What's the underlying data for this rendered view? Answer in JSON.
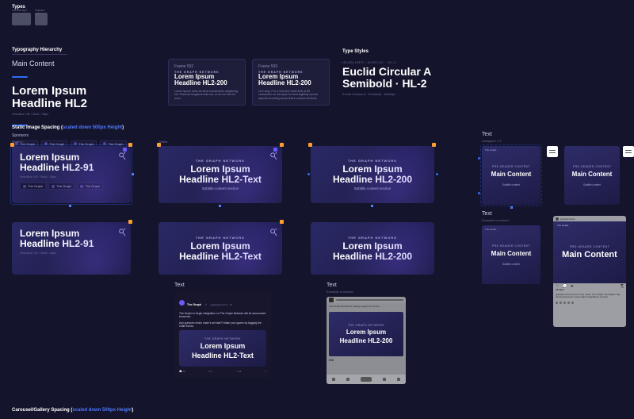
{
  "colors": {
    "accent": "#2f6cf5",
    "orange": "#ff9f2e",
    "purple": "#6a5af9",
    "bg": "#14142c",
    "panel": "#1e1d3a",
    "ink": "#ffffff",
    "dim": "#a09fc9"
  },
  "types": {
    "label": "Types",
    "swatches": [
      "Landscape",
      "Square 1:1"
    ]
  },
  "typography": {
    "label": "Typography Hierarchy",
    "main_pre": "Main Content",
    "headline_1": "Lorem Ipsum",
    "headline_2": "Headline HL2",
    "caption": "Headline Hl2 / Bold / 48px",
    "sponsors_label": "Sponsors",
    "sponsor_pill": "The Graph"
  },
  "frames": {
    "f592": {
      "title": "Frame 592",
      "kicker": "THE GRAPH NETWORK",
      "h1": "Lorem Ipsum",
      "h2": "Headline HL2-200",
      "para": "Lorem ipsum dolor sit amet consectetur adipiscing elit. Placerat feugiat at duis est, et sit non elit elit nunc."
    },
    "f593": {
      "title": "Frame 593",
      "kicker": "THE GRAPH NETWORK",
      "h1": "Lorem Ipsum",
      "h2": "Headline HL2-200",
      "note": "HL2 long: Put a max text width limit of 85 characters on this style for best legibility across layouts including social share content sections"
    }
  },
  "typestyles": {
    "label": "Type Styles",
    "tiny": "HEADLINES / DISPLAY · HL-2",
    "name_1": "Euclid Circular A",
    "name_2": "Semibold · HL-2",
    "meta": "Euclid Circular A · Semibold · 56/60px"
  },
  "staticSpacing": {
    "label_a": "Static Image Spacing (",
    "label_b": "scaled down 500px Height",
    "label_c": ")",
    "tiny_t": "T...",
    "scratch": "Scratch..."
  },
  "left_cards": {
    "kicker": "THE GRAPH NETWORK",
    "h1": "Lorem Ipsum",
    "h2": "Headline HL2-91",
    "sub": "Headline Hl2 / Bold / 48px",
    "pill": "The Graph"
  },
  "col2": {
    "label": "Twitter",
    "kicker": "THE GRAPH NETWORK",
    "h1": "Lorem Ipsum",
    "h2": "Headline HL2-Text",
    "sub": "Subtitle content section"
  },
  "col3": {
    "kicker": "THE GRAPH NETWORK",
    "h1": "Lorem Ipsum",
    "h2": "Headline HL2-200",
    "sub": "Subtitle content section"
  },
  "square": {
    "label": "Text",
    "sublabel": "Instagram 1:1",
    "dims": "1080 x 1080",
    "brand": "The Graph",
    "kicker": "PRE-HEADER CONTENT",
    "main": "Main Content",
    "subtitle": "Subtitle content"
  },
  "tweet": {
    "frame_label": "Text",
    "name": "The Graph",
    "handle": "@graphprotocol · 1h",
    "verified": "✓",
    "line1": "The Graph to begin integration on The Graph Network will be announced tomorrow.",
    "line2": "Any guesses which chain's set last?! Make your guess by tagging the chain below.",
    "media_kicker": "THE GRAPH NETWORK",
    "media_h1": "Lorem Ipsum",
    "media_h2": "Headline HL2-Text",
    "reply": "12",
    "rt": "7",
    "like": "64",
    "share": "↗"
  },
  "phone": {
    "frame_label": "Text",
    "example": "Example in context",
    "top_line": "The Graph Network is adding support for a new…",
    "card_kicker": "THE GRAPH NETWORK",
    "card_h1": "Lorem Ipsum",
    "card_h2": "Headline HL2-200",
    "likes": "808"
  },
  "ig": {
    "frame_label": "Text",
    "example": "Example in context",
    "name": "graphprotocol",
    "kicker": "PRE-HEADER CONTENT",
    "main": "Main Content",
    "likes": "47 likes",
    "caption": "graphprotocol Far from any coast. The Graph Foundation has announced more cross-chain integrations coming…"
  },
  "footer": {
    "a": "Carousel/Gallery Spacing (",
    "b": "scaled down 500px Height",
    "c": ")"
  }
}
